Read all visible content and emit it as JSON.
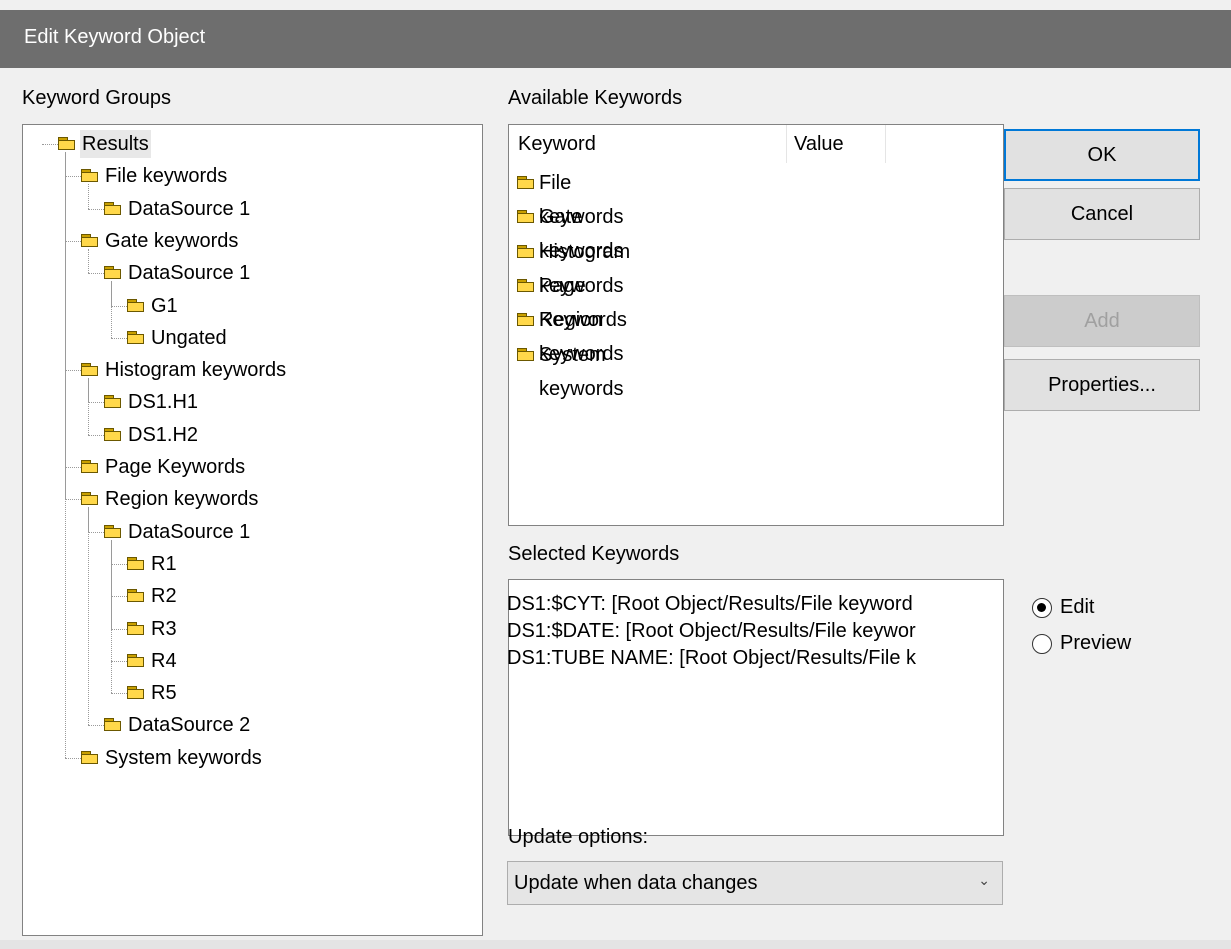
{
  "window": {
    "title": "Edit Keyword Object"
  },
  "groups": {
    "label": "Keyword Groups",
    "tree": [
      {
        "label": "Results",
        "depth": 0,
        "name": "tree-item-results"
      },
      {
        "label": "File keywords",
        "depth": 1,
        "name": "tree-item-file-keywords"
      },
      {
        "label": "DataSource 1",
        "depth": 2,
        "name": "tree-item-file-datasource-1"
      },
      {
        "label": "Gate keywords",
        "depth": 1,
        "name": "tree-item-gate-keywords"
      },
      {
        "label": "DataSource 1",
        "depth": 2,
        "name": "tree-item-gate-datasource-1"
      },
      {
        "label": "G1",
        "depth": 3,
        "name": "tree-item-g1"
      },
      {
        "label": "Ungated",
        "depth": 3,
        "name": "tree-item-ungated"
      },
      {
        "label": "Histogram keywords",
        "depth": 1,
        "name": "tree-item-histogram-keywords"
      },
      {
        "label": "DS1.H1",
        "depth": 2,
        "name": "tree-item-ds1-h1"
      },
      {
        "label": "DS1.H2",
        "depth": 2,
        "name": "tree-item-ds1-h2"
      },
      {
        "label": "Page Keywords",
        "depth": 1,
        "name": "tree-item-page-keywords"
      },
      {
        "label": "Region keywords",
        "depth": 1,
        "name": "tree-item-region-keywords"
      },
      {
        "label": "DataSource 1",
        "depth": 2,
        "name": "tree-item-region-datasource-1"
      },
      {
        "label": "R1",
        "depth": 3,
        "name": "tree-item-r1"
      },
      {
        "label": "R2",
        "depth": 3,
        "name": "tree-item-r2"
      },
      {
        "label": "R3",
        "depth": 3,
        "name": "tree-item-r3"
      },
      {
        "label": "R4",
        "depth": 3,
        "name": "tree-item-r4"
      },
      {
        "label": "R5",
        "depth": 3,
        "name": "tree-item-r5"
      },
      {
        "label": "DataSource 2",
        "depth": 2,
        "name": "tree-item-region-datasource-2"
      },
      {
        "label": "System keywords",
        "depth": 1,
        "name": "tree-item-system-keywords"
      }
    ]
  },
  "available": {
    "label": "Available Keywords",
    "columns": {
      "keyword": "Keyword",
      "value": "Value"
    },
    "items": [
      "File keywords",
      "Gate keywords",
      "Histogram keywords",
      "Page Keywords",
      "Region keywords",
      "System keywords"
    ]
  },
  "selected": {
    "label": "Selected Keywords",
    "lines": [
      "DS1:$CYT: [Root Object/Results/File keyword",
      "DS1:$DATE: [Root Object/Results/File keywor",
      "DS1:TUBE NAME: [Root Object/Results/File k"
    ]
  },
  "update": {
    "label": "Update options:",
    "value": "Update when data changes"
  },
  "buttons": {
    "ok": "OK",
    "cancel": "Cancel",
    "add": "Add",
    "properties": "Properties..."
  },
  "mode": {
    "edit": "Edit",
    "preview": "Preview",
    "selected": "edit"
  }
}
